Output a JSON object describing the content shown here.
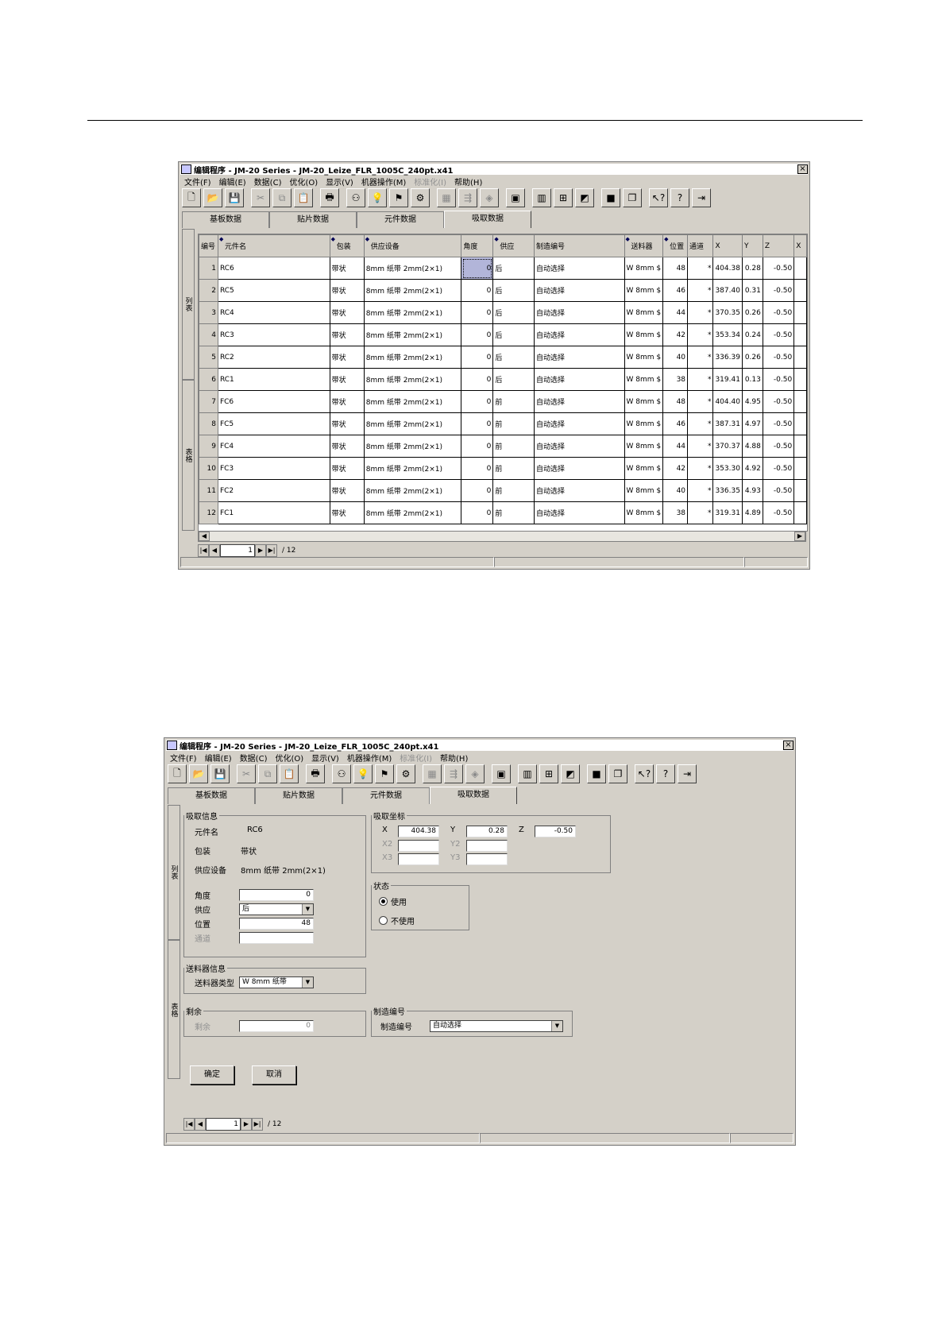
{
  "window_title": "编辑程序 - JM-20 Series - JM-20_Leize_FLR_1005C_240pt.x41",
  "menu": [
    {
      "label": "文件(F)",
      "enabled": true
    },
    {
      "label": "编辑(E)",
      "enabled": true
    },
    {
      "label": "数据(C)",
      "enabled": true
    },
    {
      "label": "优化(O)",
      "enabled": true
    },
    {
      "label": "显示(V)",
      "enabled": true
    },
    {
      "label": "机器操作(M)",
      "enabled": true
    },
    {
      "label": "标准化(I)",
      "enabled": false
    },
    {
      "label": "帮助(H)",
      "enabled": true
    }
  ],
  "toolbar": [
    {
      "icon": "new-file-icon",
      "glyph": "🗋",
      "enabled": true
    },
    {
      "icon": "open-folder-icon",
      "glyph": "📂",
      "enabled": true
    },
    {
      "icon": "save-icon",
      "glyph": "💾",
      "enabled": true
    },
    {
      "icon": "cut-icon",
      "glyph": "✂",
      "enabled": false
    },
    {
      "icon": "copy-icon",
      "glyph": "⧉",
      "enabled": false
    },
    {
      "icon": "paste-icon",
      "glyph": "📋",
      "enabled": false
    },
    {
      "icon": "print-icon",
      "glyph": "🖶",
      "enabled": true
    },
    {
      "icon": "find-icon",
      "glyph": "⚇",
      "enabled": true
    },
    {
      "icon": "bulb-icon",
      "glyph": "💡",
      "enabled": true
    },
    {
      "icon": "teach-icon",
      "glyph": "⚑",
      "enabled": true
    },
    {
      "icon": "optimize-icon",
      "glyph": "⚙",
      "enabled": true
    },
    {
      "icon": "board-icon",
      "glyph": "▦",
      "enabled": false
    },
    {
      "icon": "transfer-icon",
      "glyph": "⇶",
      "enabled": false
    },
    {
      "icon": "component-icon",
      "glyph": "◈",
      "enabled": false
    },
    {
      "icon": "chip-icon",
      "glyph": "▣",
      "enabled": true
    },
    {
      "icon": "column-icon",
      "glyph": "▥",
      "enabled": true
    },
    {
      "icon": "nozzle-icon",
      "glyph": "⊞",
      "enabled": true
    },
    {
      "icon": "feeder-icon",
      "glyph": "◩",
      "enabled": true
    },
    {
      "icon": "stop-icon",
      "glyph": "■",
      "enabled": true
    },
    {
      "icon": "layers-icon",
      "glyph": "❐",
      "enabled": true
    },
    {
      "icon": "context-help-icon",
      "glyph": "↖?",
      "enabled": true
    },
    {
      "icon": "help-icon",
      "glyph": "?",
      "enabled": true
    },
    {
      "icon": "exit-icon",
      "glyph": "⇥",
      "enabled": true
    }
  ],
  "tabs": [
    "基板数据",
    "贴片数据",
    "元件数据",
    "吸取数据"
  ],
  "active_tab": 3,
  "vertical_tabs": [
    "列表",
    "表格"
  ],
  "grid": {
    "headers": [
      "编号",
      "元件名",
      "包装",
      "供应设备",
      "角度",
      "供应",
      "制造编号",
      "送料器",
      "位置",
      "通道",
      "X",
      "Y",
      "Z",
      "X"
    ],
    "sortable": [
      false,
      true,
      true,
      true,
      false,
      true,
      false,
      true,
      true,
      false,
      false,
      false,
      false,
      false
    ],
    "rows": [
      [
        "1",
        "RC6",
        "带状",
        "8mm 纸带 2mm(2×1)",
        "0",
        "后",
        "自动选择",
        "W 8mm $",
        "48",
        "*",
        "404.38",
        "0.28",
        "-0.50"
      ],
      [
        "2",
        "RC5",
        "带状",
        "8mm 纸带 2mm(2×1)",
        "0",
        "后",
        "自动选择",
        "W 8mm $",
        "46",
        "*",
        "387.40",
        "0.31",
        "-0.50"
      ],
      [
        "3",
        "RC4",
        "带状",
        "8mm 纸带 2mm(2×1)",
        "0",
        "后",
        "自动选择",
        "W 8mm $",
        "44",
        "*",
        "370.35",
        "0.26",
        "-0.50"
      ],
      [
        "4",
        "RC3",
        "带状",
        "8mm 纸带 2mm(2×1)",
        "0",
        "后",
        "自动选择",
        "W 8mm $",
        "42",
        "*",
        "353.34",
        "0.24",
        "-0.50"
      ],
      [
        "5",
        "RC2",
        "带状",
        "8mm 纸带 2mm(2×1)",
        "0",
        "后",
        "自动选择",
        "W 8mm $",
        "40",
        "*",
        "336.39",
        "0.26",
        "-0.50"
      ],
      [
        "6",
        "RC1",
        "带状",
        "8mm 纸带 2mm(2×1)",
        "0",
        "后",
        "自动选择",
        "W 8mm $",
        "38",
        "*",
        "319.41",
        "0.13",
        "-0.50"
      ],
      [
        "7",
        "FC6",
        "带状",
        "8mm 纸带 2mm(2×1)",
        "0",
        "前",
        "自动选择",
        "W 8mm $",
        "48",
        "*",
        "404.40",
        "4.95",
        "-0.50"
      ],
      [
        "8",
        "FC5",
        "带状",
        "8mm 纸带 2mm(2×1)",
        "0",
        "前",
        "自动选择",
        "W 8mm $",
        "46",
        "*",
        "387.31",
        "4.97",
        "-0.50"
      ],
      [
        "9",
        "FC4",
        "带状",
        "8mm 纸带 2mm(2×1)",
        "0",
        "前",
        "自动选择",
        "W 8mm $",
        "44",
        "*",
        "370.37",
        "4.88",
        "-0.50"
      ],
      [
        "10",
        "FC3",
        "带状",
        "8mm 纸带 2mm(2×1)",
        "0",
        "前",
        "自动选择",
        "W 8mm $",
        "42",
        "*",
        "353.30",
        "4.92",
        "-0.50"
      ],
      [
        "11",
        "FC2",
        "带状",
        "8mm 纸带 2mm(2×1)",
        "0",
        "前",
        "自动选择",
        "W 8mm $",
        "40",
        "*",
        "336.35",
        "4.93",
        "-0.50"
      ],
      [
        "12",
        "FC1",
        "带状",
        "8mm 纸带 2mm(2×1)",
        "0",
        "前",
        "自动选择",
        "W 8mm $",
        "38",
        "*",
        "319.31",
        "4.89",
        "-0.50"
      ]
    ]
  },
  "pager": {
    "current": "1",
    "total": "/ 12"
  },
  "form": {
    "pick_info": {
      "legend": "吸取信息",
      "component_name_label": "元件名",
      "component_name": "RC6",
      "package_label": "包装",
      "package": "带状",
      "feeder_device_label": "供应设备",
      "feeder_device": "8mm 纸带 2mm(2×1)",
      "angle_label": "角度",
      "angle": "0",
      "supply_label": "供应",
      "supply": "后",
      "position_label": "位置",
      "position": "48",
      "channel_label": "通道",
      "channel": ""
    },
    "pick_coords": {
      "legend": "吸取坐标",
      "x_label": "X",
      "x": "404.38",
      "y_label": "Y",
      "y": "0.28",
      "z_label": "Z",
      "z": "-0.50",
      "x2_label": "X2",
      "x2": "",
      "y2_label": "Y2",
      "y2": "",
      "x3_label": "X3",
      "x3": "",
      "y3_label": "Y3",
      "y3": ""
    },
    "status": {
      "legend": "状态",
      "use": "使用",
      "not_use": "不使用",
      "selected": "use"
    },
    "feeder_info": {
      "legend": "送料器信息",
      "type_label": "送料器类型",
      "type": "W 8mm 纸带"
    },
    "remaining": {
      "legend": "剩余",
      "label": "剩余",
      "value": "0"
    },
    "mfg_number": {
      "legend": "制造编号",
      "label": "制造编号",
      "value": "自动选择"
    },
    "ok": "确定",
    "cancel": "取消"
  }
}
